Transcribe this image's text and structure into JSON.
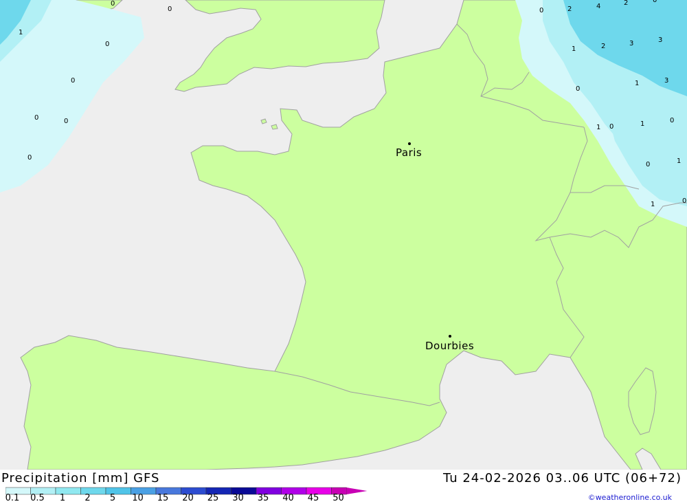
{
  "header": {
    "title": "Precipitation [mm] GFS",
    "valid_time": "Tu 24-02-2026 03..06 UTC (06+72)",
    "credit": "©weatheronline.co.uk"
  },
  "legend": {
    "ticks": [
      "0.1",
      "0.5",
      "1",
      "2",
      "5",
      "10",
      "15",
      "20",
      "25",
      "30",
      "35",
      "40",
      "45",
      "50"
    ],
    "colors": [
      "#d4f8fa",
      "#b2f0f5",
      "#90e8f0",
      "#6ed8ec",
      "#50c4e8",
      "#4aa0e4",
      "#4878dc",
      "#2c4cd0",
      "#1426b4",
      "#0a0a96",
      "#8000e0",
      "#b000e8",
      "#e800e8",
      "#c800b4"
    ]
  },
  "cities": [
    {
      "name": "Paris"
    },
    {
      "name": "Dourbies"
    }
  ],
  "precip_labels": [
    "0",
    "0",
    "1",
    "0",
    "0",
    "0",
    "0",
    "0",
    "0",
    "0",
    "2",
    "4",
    "2",
    "0",
    "1",
    "2",
    "3",
    "3",
    "0",
    "1",
    "3",
    "0",
    "1",
    "0",
    "1",
    "1",
    "1",
    "0"
  ],
  "colors": {
    "sea": "#eeeeee",
    "land": "#ccff9f",
    "border": "#a0a0a0",
    "precip_light": "#d4f8fa",
    "precip_mid": "#b2f0f5",
    "precip_high": "#6ed8ec"
  }
}
